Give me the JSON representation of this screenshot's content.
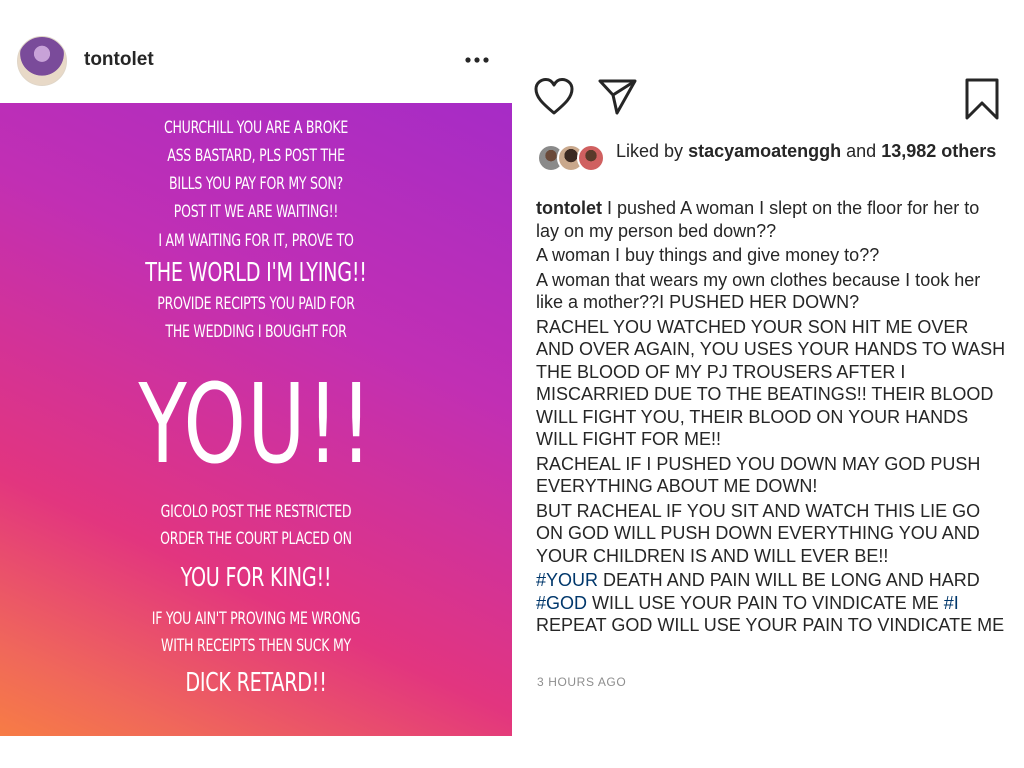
{
  "post": {
    "username": "tontolet",
    "avatar_icon": "profile-photo",
    "more_icon": "more-horizontal-icon"
  },
  "story_lines": [
    {
      "text": "CHURCHILL YOU ARE A BROKE",
      "size": "s"
    },
    {
      "text": "ASS BASTARD, PLS POST THE",
      "size": "s"
    },
    {
      "text": "BILLS YOU PAY FOR MY SON?",
      "size": "s"
    },
    {
      "text": "POST IT WE ARE WAITING!!",
      "size": "s"
    },
    {
      "text": "I AM WAITING FOR IT, PROVE TO",
      "size": "s"
    },
    {
      "text": "THE WORLD I'M LYING!!",
      "size": "m"
    },
    {
      "text": "PROVIDE RECIPTS YOU PAID FOR",
      "size": "s"
    },
    {
      "text": "THE WEDDING I BOUGHT FOR",
      "size": "s"
    },
    {
      "text": "YOU!!",
      "size": "xl"
    },
    {
      "text": "GICOLO POST THE RESTRICTED",
      "size": "s"
    },
    {
      "text": "ORDER THE COURT PLACED ON",
      "size": "s"
    },
    {
      "text": "YOU FOR KING!!",
      "size": "m"
    },
    {
      "text": "IF YOU AIN'T PROVING ME WRONG",
      "size": "s"
    },
    {
      "text": "WITH RECEIPTS THEN SUCK MY",
      "size": "s"
    },
    {
      "text": "DICK RETARD!!",
      "size": "m"
    }
  ],
  "actions": {
    "like_icon": "heart-icon",
    "share_icon": "paper-plane-icon",
    "save_icon": "bookmark-icon"
  },
  "likes": {
    "prefix": "Liked by",
    "user": "stacyamoatenggh",
    "conj": "and",
    "count": "13,982",
    "suffix": "others"
  },
  "caption": {
    "author": "tontolet",
    "paragraphs": [
      [
        {
          "t": "I pushed A woman I slept on the floor for her to lay on my person bed down??"
        }
      ],
      [
        {
          "t": "A woman I buy things and give money to??"
        }
      ],
      [
        {
          "t": "A woman that wears my own clothes because I took her like a mother??I PUSHED HER DOWN?"
        }
      ],
      [
        {
          "t": "RACHEL YOU WATCHED YOUR SON HIT ME OVER AND OVER AGAIN, YOU USES YOUR HANDS TO WASH THE BLOOD OF MY PJ TROUSERS AFTER I MISCARRIED DUE TO THE BEATINGS!! THEIR BLOOD WILL FIGHT YOU, THEIR BLOOD ON YOUR HANDS WILL FIGHT FOR ME!!"
        }
      ],
      [
        {
          "t": "RACHEAL IF I PUSHED YOU DOWN MAY GOD PUSH EVERYTHING ABOUT ME DOWN!"
        }
      ],
      [
        {
          "t": "BUT RACHEAL IF YOU SIT AND WATCH THIS LIE GO ON GOD WILL PUSH DOWN EVERYTHING YOU AND YOUR CHILDREN  IS AND WILL EVER BE!!"
        }
      ],
      [
        {
          "t": "#YOUR",
          "tag": true
        },
        {
          "t": " DEATH AND PAIN WILL BE LONG AND HARD "
        },
        {
          "t": "#GOD",
          "tag": true
        },
        {
          "t": " WILL USE YOUR PAIN TO VINDICATE ME "
        },
        {
          "t": "#I",
          "tag": true
        },
        {
          "t": " REPEAT GOD WILL USE YOUR PAIN TO VINDICATE ME"
        }
      ]
    ]
  },
  "timestamp": "3 HOURS AGO",
  "colors": {
    "hashtag": "#00376b",
    "timestamp": "#8e8e8e",
    "text": "#262626",
    "story_gradient": [
      "#a62cc6",
      "#e2357f",
      "#f77c45"
    ]
  }
}
